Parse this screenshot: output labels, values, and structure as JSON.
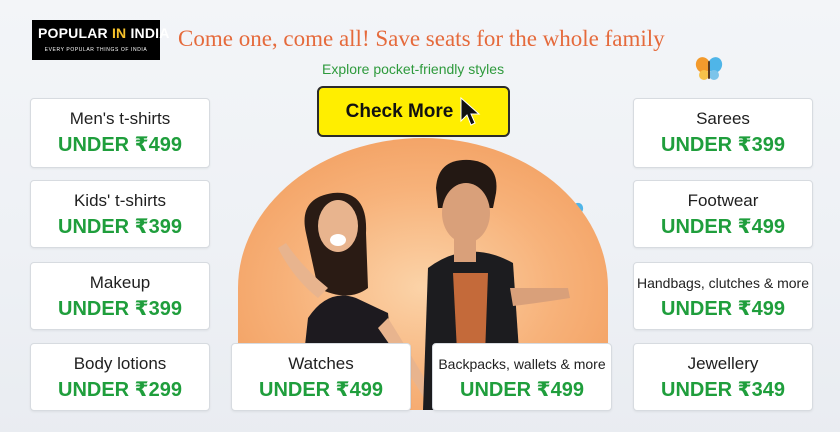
{
  "brand": {
    "name_part1": "POPULAR ",
    "name_part2": "IN",
    "name_part3": " INDIA",
    "tagline": "EVERY POPULAR THINGS OF INDIA"
  },
  "header": {
    "headline": "Come one, come all! Save seats for the whole family",
    "subline": "Explore pocket-friendly styles"
  },
  "cta": {
    "label": "Check More",
    "icon": "cursor-arrow-icon"
  },
  "left_cards": [
    {
      "title": "Men's t-shirts",
      "price": "UNDER ₹499"
    },
    {
      "title": "Kids' t-shirts",
      "price": "UNDER ₹399"
    },
    {
      "title": "Makeup",
      "price": "UNDER ₹399"
    },
    {
      "title": "Body lotions",
      "price": "UNDER ₹299"
    }
  ],
  "center_cards": [
    {
      "title": "Watches",
      "price": "UNDER ₹499"
    },
    {
      "title": "Backpacks, wallets & more",
      "price": "UNDER ₹499"
    }
  ],
  "right_cards": [
    {
      "title": "Sarees",
      "price": "UNDER ₹399"
    },
    {
      "title": "Footwear",
      "price": "UNDER ₹499"
    },
    {
      "title": "Handbags, clutches & more",
      "price": "UNDER ₹499"
    },
    {
      "title": "Jewellery",
      "price": "UNDER ₹349"
    }
  ],
  "colors": {
    "headline": "#e56a3c",
    "price_green": "#1f9e3c",
    "cta_yellow": "#ffee00",
    "hero_orange": "#f7b27a"
  },
  "icons": [
    "butterfly-icon",
    "cursor-arrow-icon"
  ]
}
